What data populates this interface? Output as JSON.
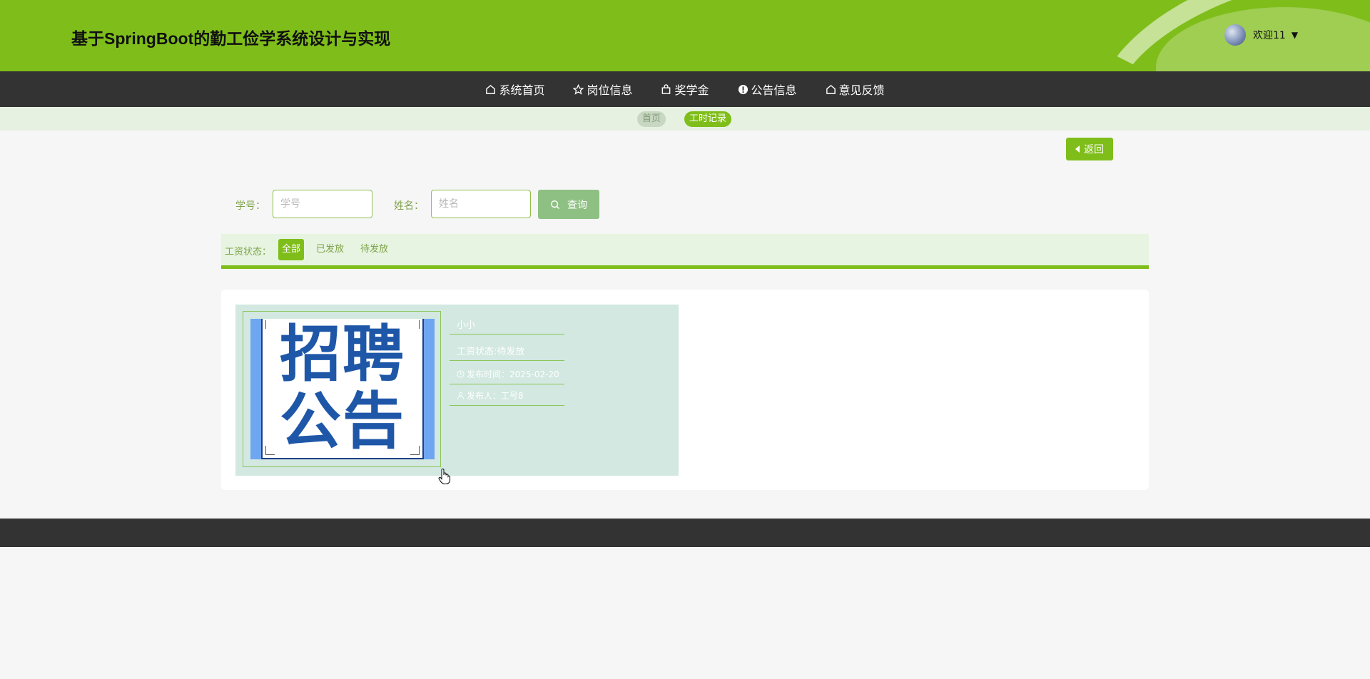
{
  "header": {
    "title": "基于SpringBoot的勤工俭学系统设计与实现",
    "user_greeting": "欢迎11"
  },
  "nav": {
    "items": [
      {
        "label": "系统首页",
        "icon": "home-icon"
      },
      {
        "label": "岗位信息",
        "icon": "star-icon"
      },
      {
        "label": "奖学金",
        "icon": "bag-icon"
      },
      {
        "label": "公告信息",
        "icon": "alert-icon"
      },
      {
        "label": "意见反馈",
        "icon": "home-icon"
      }
    ]
  },
  "breadcrumb": {
    "home": "首页",
    "current": "工时记录"
  },
  "back_label": "返回",
  "search": {
    "student_id_label": "学号：",
    "student_id_placeholder": "学号",
    "name_label": "姓名：",
    "name_placeholder": "姓名",
    "button_label": "查询"
  },
  "filter": {
    "label": "工资状态：",
    "options": [
      "全部",
      "已发放",
      "待发放"
    ],
    "selected": "全部"
  },
  "records": [
    {
      "poster_line1": "招聘",
      "poster_line2": "公告",
      "name": "小小",
      "status": "工资状态:待发放",
      "publish_time": "发布时间：2025-02-20",
      "publisher": "发布人：工号8"
    }
  ],
  "colors": {
    "brand_green": "#7fbe1a",
    "nav_dark": "#333333",
    "card_bg": "#d2e8e1"
  }
}
